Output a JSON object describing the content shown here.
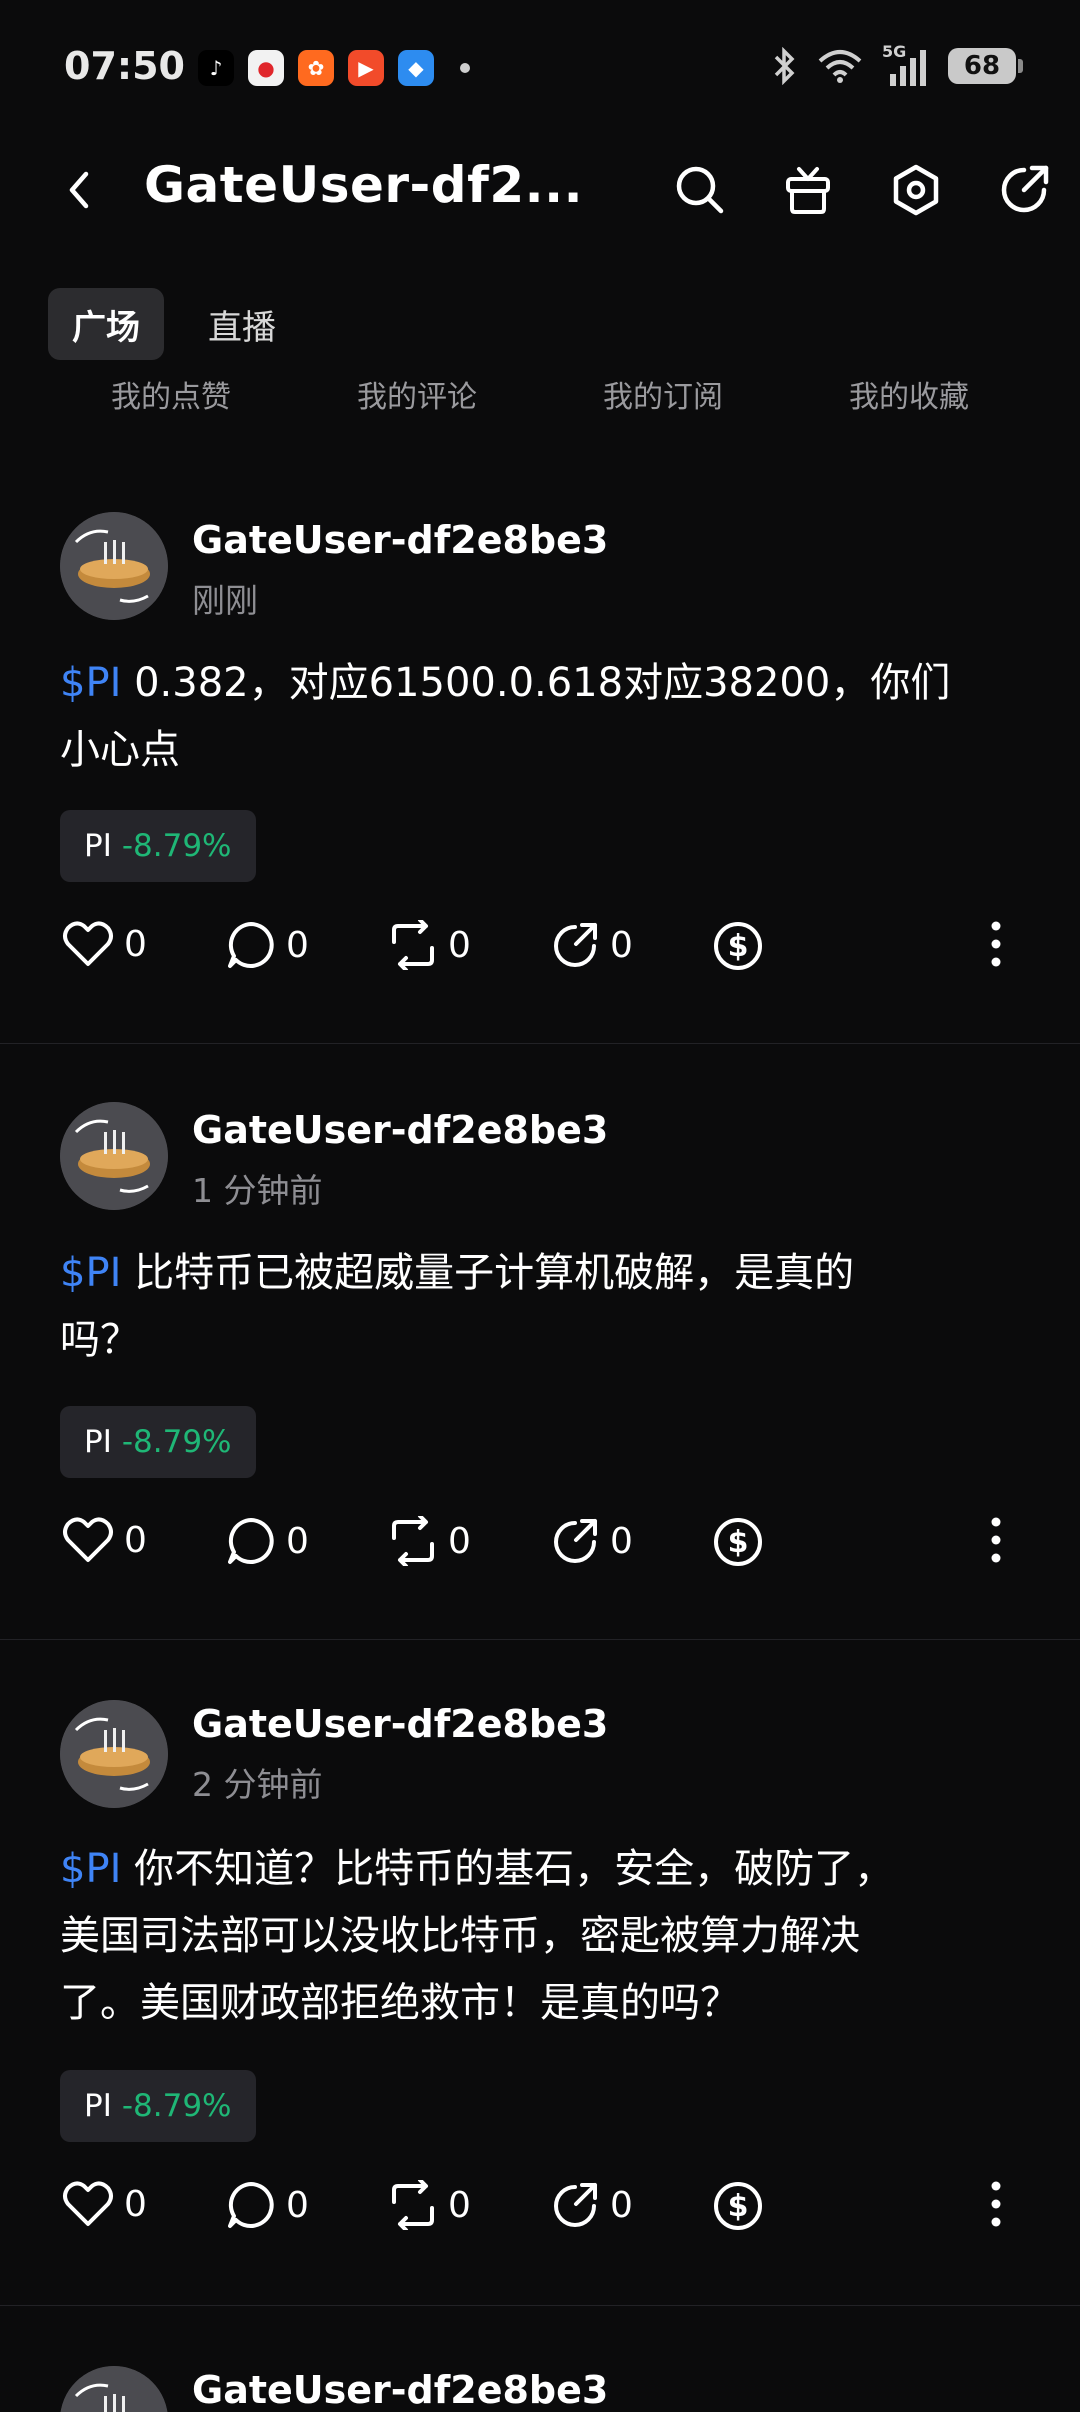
{
  "status_bar": {
    "time": "07:50",
    "battery": "68",
    "network": "5G"
  },
  "header": {
    "title": "GateUser-df2..."
  },
  "tabs": [
    {
      "label": "广场",
      "active": true
    },
    {
      "label": "直播",
      "active": false
    }
  ],
  "subtabs": [
    "我的点赞",
    "我的评论",
    "我的订阅",
    "我的收藏"
  ],
  "posts": [
    {
      "author": "GateUser-df2e8be3",
      "time": "刚刚",
      "ticker": "$PI",
      "lines": [
        "0.382，对应61500.0.618对应38200，你们",
        "小心点"
      ],
      "coin": {
        "symbol": "PI",
        "change": "-8.79%"
      },
      "likes": "0",
      "comments": "0",
      "reposts": "0",
      "shares": "0"
    },
    {
      "author": "GateUser-df2e8be3",
      "time": "1 分钟前",
      "ticker": "$PI",
      "lines": [
        "比特币已被超威量子计算机破解，是真的",
        "吗？"
      ],
      "coin": {
        "symbol": "PI",
        "change": "-8.79%"
      },
      "likes": "0",
      "comments": "0",
      "reposts": "0",
      "shares": "0"
    },
    {
      "author": "GateUser-df2e8be3",
      "time": "2 分钟前",
      "ticker": "$PI",
      "lines": [
        "你不知道？比特币的基石，安全，破防了，",
        "美国司法部可以没收比特币，密匙被算力解决",
        "了。美国财政部拒绝救市！是真的吗？"
      ],
      "coin": {
        "symbol": "PI",
        "change": "-8.79%"
      },
      "likes": "0",
      "comments": "0",
      "reposts": "0",
      "shares": "0"
    },
    {
      "author": "GateUser-df2e8be3"
    }
  ],
  "colors": {
    "background": "#0b0b0c",
    "ticker": "#3f84f6",
    "positive_negative_change": "#1fb776",
    "tag_bg": "#25252a"
  },
  "icons": [
    "back-arrow-icon",
    "search-icon",
    "gift-icon",
    "settings-hex-icon",
    "share-icon",
    "heart-icon",
    "comment-icon",
    "repost-icon",
    "forward-icon",
    "tip-dollar-icon",
    "more-vertical-icon"
  ]
}
